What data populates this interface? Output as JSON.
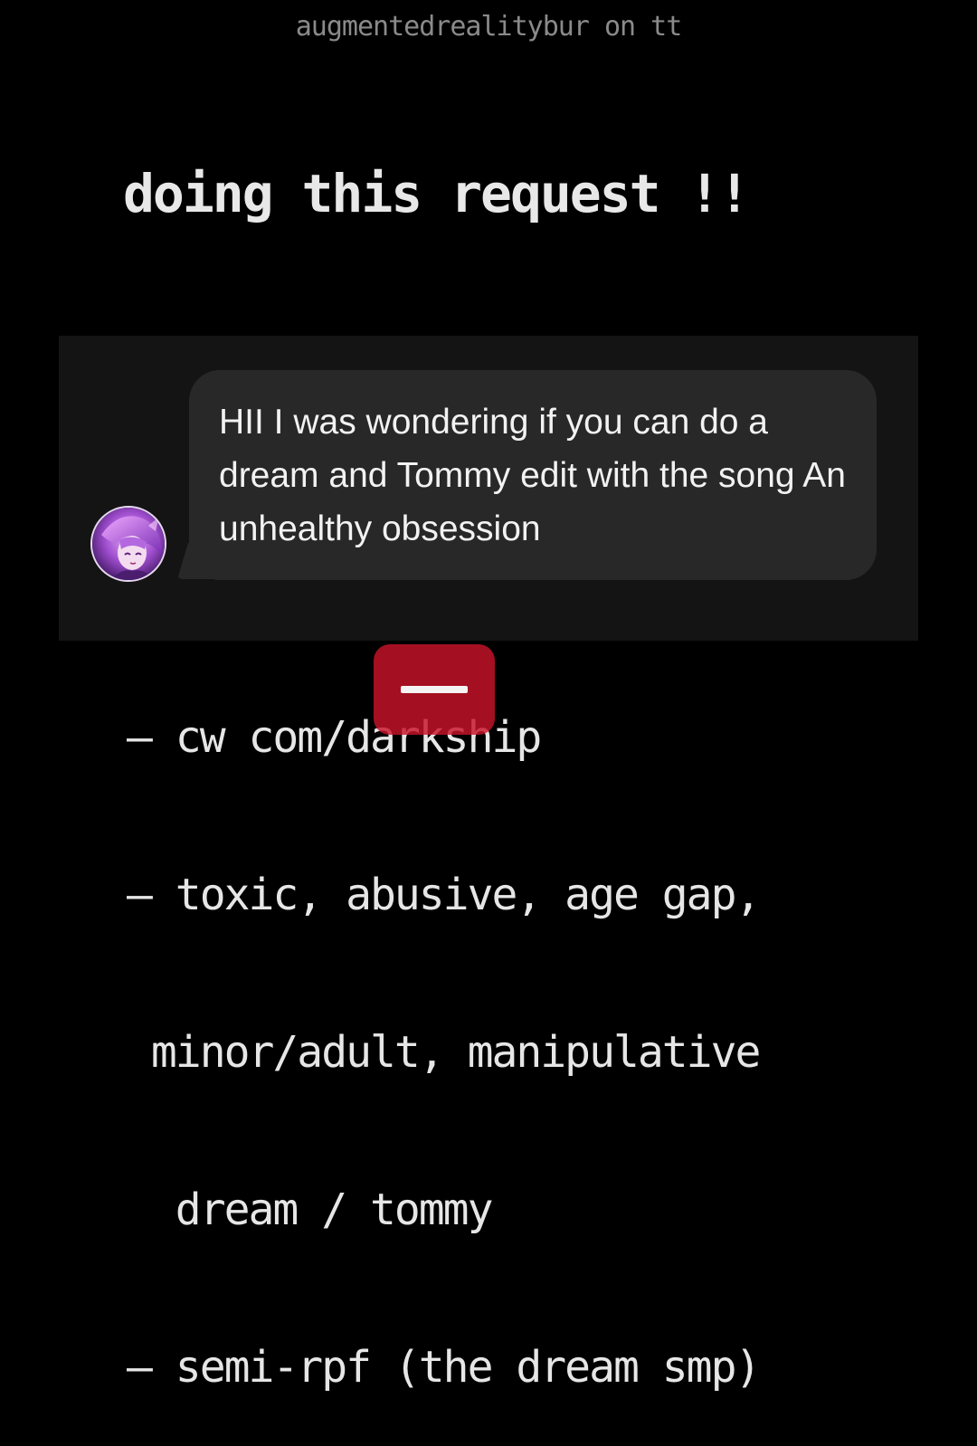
{
  "watermark": "augmentedrealitybur on tt",
  "headline": "doing this request !!",
  "message": {
    "text": "HII I was wondering if you can do a dream and Tommy edit with the song An unhealthy obsession"
  },
  "avatar_icon": "anime-character-avatar-icon",
  "warnings": [
    "— cw com/darkship",
    "— toxic, abusive, age gap,",
    " minor/adult, manipulative",
    "  dream / tommy",
    "— semi-rpf (the dream smp)"
  ],
  "overlay": {
    "icon": "minus-icon"
  },
  "colors": {
    "background": "#000000",
    "panel": "#141414",
    "bubble": "#282828",
    "overlay_red": "#c81428"
  }
}
